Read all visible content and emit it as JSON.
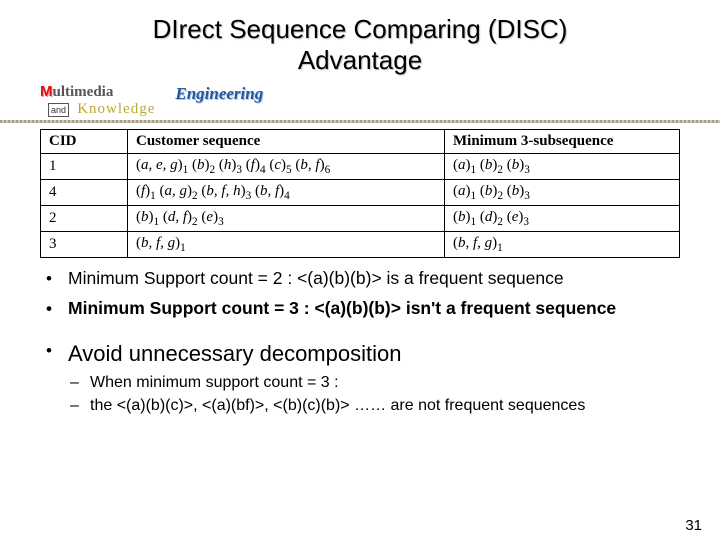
{
  "title": "DIrect Sequence Comparing (DISC)",
  "subtitle": "Advantage",
  "letterhead": {
    "w1": "ultimedia",
    "and": "and",
    "w2": "nowledge",
    "eng": "Engineering"
  },
  "table": {
    "headers": [
      "CID",
      "Customer sequence",
      "Minimum 3-subsequence"
    ],
    "rows": [
      {
        "cid": "1",
        "seq_html": "(<i>a, e, g</i>)<span class='sub'>1</span> (<i>b</i>)<span class='sub'>2</span> (<i>h</i>)<span class='sub'>3</span> (<i>f</i>)<span class='sub'>4</span> (<i>c</i>)<span class='sub'>5</span> (<i>b, f</i>)<span class='sub'>6</span>",
        "min_html": "(<i>a</i>)<span class='sub'>1</span> (<i>b</i>)<span class='sub'>2</span> (<i>b</i>)<span class='sub'>3</span>"
      },
      {
        "cid": "4",
        "seq_html": "(<i>f</i>)<span class='sub'>1</span> (<i>a, g</i>)<span class='sub'>2</span> (<i>b, f, h</i>)<span class='sub'>3</span> (<i>b, f</i>)<span class='sub'>4</span>",
        "min_html": "(<i>a</i>)<span class='sub'>1</span> (<i>b</i>)<span class='sub'>2</span> (<i>b</i>)<span class='sub'>3</span>"
      },
      {
        "cid": "2",
        "seq_html": "(<i>b</i>)<span class='sub'>1</span> (<i>d, f</i>)<span class='sub'>2</span> (<i>e</i>)<span class='sub'>3</span>",
        "min_html": "(<i>b</i>)<span class='sub'>1</span> (<i>d</i>)<span class='sub'>2</span> (<i>e</i>)<span class='sub'>3</span>"
      },
      {
        "cid": "3",
        "seq_html": "(<i>b, f, g</i>)<span class='sub'>1</span>",
        "min_html": "(<i>b, f, g</i>)<span class='sub'>1</span>"
      }
    ]
  },
  "bullets": {
    "b1": "Minimum Support count = 2 : <(a)(b)(b)> is a frequent sequence",
    "b2": "Minimum Support count = 3 : <(a)(b)(b)> isn't a frequent sequence",
    "b3": "Avoid unnecessary decomposition",
    "sub1": "When minimum support count = 3 :",
    "sub2": "the <(a)(b)(c)>, <(a)(bf)>, <(b)(c)(b)> …… are not frequent sequences"
  },
  "pagenum": "31"
}
